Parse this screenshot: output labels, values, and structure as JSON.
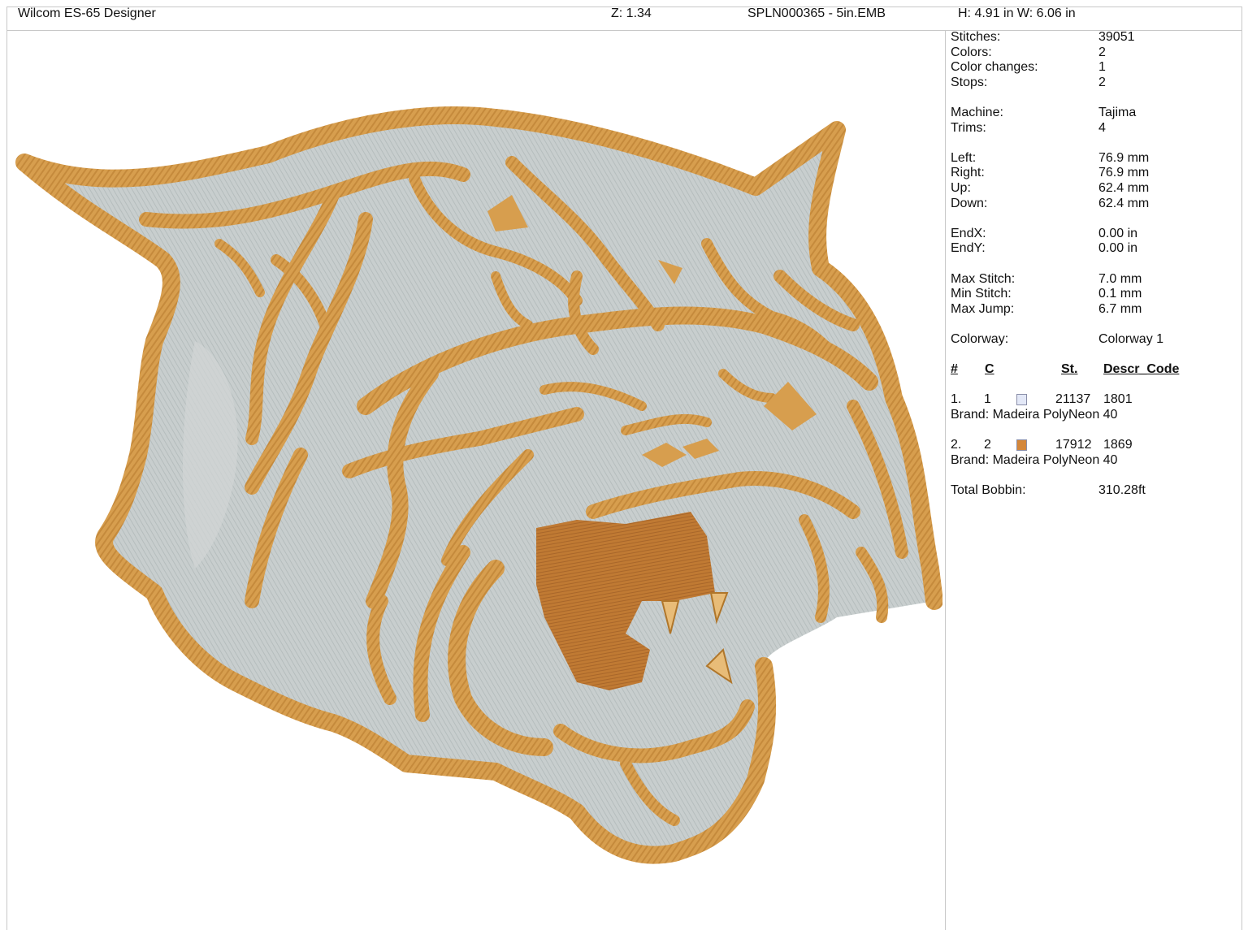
{
  "header": {
    "app_title": "Wilcom ES-65 Designer",
    "zoom": "Z: 1.34",
    "file_name": "SPLN000365 - 5in.EMB",
    "dimensions": "H: 4.91 in   W: 6.06 in"
  },
  "stats": {
    "stitches": {
      "label": "Stitches:",
      "value": "39051"
    },
    "colors": {
      "label": "Colors:",
      "value": "2"
    },
    "color_changes": {
      "label": "Color changes:",
      "value": "1"
    },
    "stops": {
      "label": "Stops:",
      "value": "2"
    },
    "machine": {
      "label": "Machine:",
      "value": "Tajima"
    },
    "trims": {
      "label": "Trims:",
      "value": "4"
    },
    "left": {
      "label": "Left:",
      "value": "76.9 mm"
    },
    "right": {
      "label": "Right:",
      "value": "76.9 mm"
    },
    "up": {
      "label": "Up:",
      "value": "62.4 mm"
    },
    "down": {
      "label": "Down:",
      "value": "62.4 mm"
    },
    "endx": {
      "label": "EndX:",
      "value": "0.00 in"
    },
    "endy": {
      "label": "EndY:",
      "value": "0.00 in"
    },
    "max_stitch": {
      "label": "Max Stitch:",
      "value": "7.0 mm"
    },
    "min_stitch": {
      "label": "Min Stitch:",
      "value": "0.1 mm"
    },
    "max_jump": {
      "label": "Max Jump:",
      "value": "6.7 mm"
    },
    "colorway": {
      "label": "Colorway:",
      "value": "Colorway 1"
    }
  },
  "color_table": {
    "headers": {
      "num": "#",
      "c": "C",
      "st": "St.",
      "descr_code": "Descr_Code"
    },
    "rows": [
      {
        "index": "1.",
        "c": "1",
        "swatch": "#e3e8f7",
        "stitches": "21137",
        "code": "1801",
        "brand": "Brand: Madeira PolyNeon 40"
      },
      {
        "index": "2.",
        "c": "2",
        "swatch": "#d4873a",
        "stitches": "17912",
        "code": "1869",
        "brand": "Brand: Madeira PolyNeon 40"
      }
    ]
  },
  "bobbin": {
    "label": "Total Bobbin:",
    "value": "310.28ft"
  },
  "design": {
    "fill_color": "#c5cbcb",
    "outline_color": "#d79e4e",
    "shadow_color": "#b0762a",
    "mouth_color": "#c07a33"
  }
}
